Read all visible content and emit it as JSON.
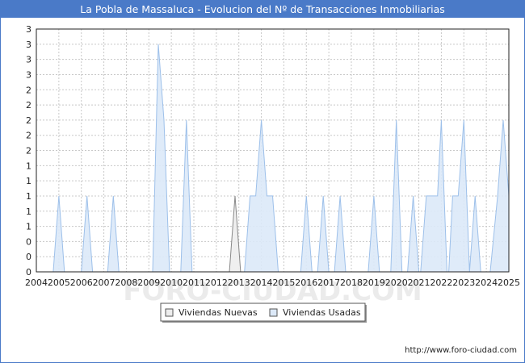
{
  "title": "La Pobla de Massaluca - Evolucion del Nº de Transacciones Inmobiliarias",
  "credit": "http://www.foro-ciudad.com",
  "watermark": "FORO-CIUDAD.COM",
  "colors": {
    "header": "#4a7ac8",
    "used_fill": "#dce9f8",
    "used_stroke": "#9dc0ea",
    "new_fill": "#eeeeee",
    "new_stroke": "#888888",
    "grid": "#c8c8c8"
  },
  "chart_data": {
    "type": "area",
    "title": "La Pobla de Massaluca - Evolucion del Nº de Transacciones Inmobiliarias",
    "xlabel": "",
    "ylabel": "",
    "x_range": [
      2004,
      2025
    ],
    "ylim": [
      0,
      3.2
    ],
    "x_tick_labels": [
      "2004",
      "2005",
      "2006",
      "2007",
      "2008",
      "2009",
      "2010",
      "2011",
      "2012",
      "2013",
      "2014",
      "2015",
      "2016",
      "2017",
      "2018",
      "2019",
      "2020",
      "2021",
      "2022",
      "2023",
      "2024",
      "2025"
    ],
    "y_tick_labels": [
      "0",
      "0",
      "0",
      "1",
      "1",
      "1",
      "1",
      "1",
      "2",
      "2",
      "2",
      "2",
      "2",
      "3",
      "3",
      "3",
      "3"
    ],
    "grid": true,
    "legend_position": "bottom",
    "series": [
      {
        "name": "Viviendas Nuevas",
        "color": "#888888",
        "points": [
          [
            2012.58,
            0
          ],
          [
            2012.83,
            1
          ],
          [
            2013.08,
            0
          ]
        ]
      },
      {
        "name": "Viviendas Usadas",
        "color": "#9dc0ea",
        "points": [
          [
            2004.75,
            0
          ],
          [
            2005.0,
            1
          ],
          [
            2005.25,
            0
          ],
          [
            2006.0,
            0
          ],
          [
            2006.25,
            1
          ],
          [
            2006.5,
            0
          ],
          [
            2007.17,
            0
          ],
          [
            2007.42,
            1
          ],
          [
            2007.67,
            0
          ],
          [
            2009.17,
            0
          ],
          [
            2009.42,
            3
          ],
          [
            2009.67,
            2
          ],
          [
            2009.92,
            0
          ],
          [
            2010.42,
            0
          ],
          [
            2010.67,
            2
          ],
          [
            2010.92,
            0
          ],
          [
            2013.25,
            0
          ],
          [
            2013.5,
            1
          ],
          [
            2013.75,
            1
          ],
          [
            2014.0,
            2
          ],
          [
            2014.25,
            1
          ],
          [
            2014.5,
            1
          ],
          [
            2014.75,
            0
          ],
          [
            2015.75,
            0
          ],
          [
            2016.0,
            1
          ],
          [
            2016.25,
            0
          ],
          [
            2016.5,
            0
          ],
          [
            2016.75,
            1
          ],
          [
            2017.0,
            0
          ],
          [
            2017.25,
            0
          ],
          [
            2017.5,
            1
          ],
          [
            2017.75,
            0
          ],
          [
            2018.75,
            0
          ],
          [
            2019.0,
            1
          ],
          [
            2019.25,
            0
          ],
          [
            2019.75,
            0
          ],
          [
            2020.0,
            2
          ],
          [
            2020.25,
            0
          ],
          [
            2020.5,
            0
          ],
          [
            2020.75,
            1
          ],
          [
            2021.0,
            0
          ],
          [
            2021.08,
            0
          ],
          [
            2021.33,
            1
          ],
          [
            2021.58,
            1
          ],
          [
            2021.83,
            1
          ],
          [
            2022.0,
            2
          ],
          [
            2022.25,
            0
          ],
          [
            2022.33,
            0
          ],
          [
            2022.5,
            1
          ],
          [
            2022.75,
            1
          ],
          [
            2023.0,
            2
          ],
          [
            2023.25,
            0
          ],
          [
            2023.25,
            0
          ],
          [
            2023.5,
            1
          ],
          [
            2023.75,
            0
          ],
          [
            2024.17,
            0
          ],
          [
            2024.5,
            1
          ],
          [
            2024.75,
            2
          ],
          [
            2025.0,
            1
          ]
        ]
      }
    ]
  }
}
